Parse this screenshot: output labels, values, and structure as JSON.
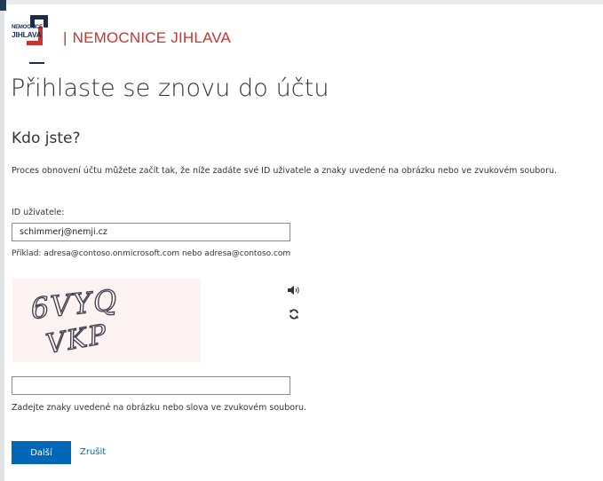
{
  "brand": {
    "logo_line1": "NEMOCNICE",
    "logo_line2": "JIHLAVA",
    "separator": "|",
    "name": "NEMOCNICE JIHLAVA"
  },
  "page_title": "Přihlaste se znovu do účtu",
  "section_title": "Kdo jste?",
  "intro_text": "Proces obnovení účtu můžete začít tak, že níže zadáte své ID uživatele a znaky uvedené na obrázku nebo ve zvukovém souboru.",
  "user_id": {
    "label": "ID uživatele:",
    "value": "schimmerj@nemji.cz",
    "example": "Příklad: adresa@contoso.onmicrosoft.com nebo adresa@contoso.com"
  },
  "captcha": {
    "line1": "6VYQ",
    "line2": "VKP",
    "audio_icon": "speaker-icon",
    "refresh_icon": "refresh-icon",
    "value": "",
    "hint": "Zadejte znaky uvedené na obrázku nebo slova ve zvukovém souboru."
  },
  "actions": {
    "next_label": "Další",
    "cancel_label": "Zrušit"
  },
  "colors": {
    "brand_red": "#c8342f",
    "brand_navy": "#1b2d4f",
    "primary_blue": "#0067b8"
  }
}
